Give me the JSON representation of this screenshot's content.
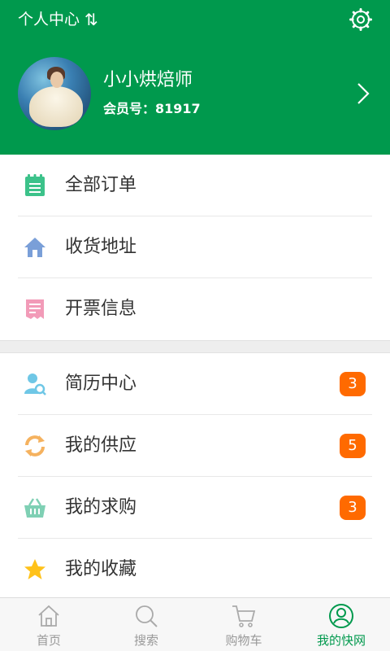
{
  "header": {
    "title": "个人中心",
    "swap_icon": "⇅",
    "username": "小小烘焙师",
    "member_label": "会员号：",
    "member_number": "81917"
  },
  "menu_group_1": [
    {
      "label": "全部订单",
      "icon": "order-list-icon",
      "color": "#3cc28a"
    },
    {
      "label": "收货地址",
      "icon": "home-icon",
      "color": "#7a9fd8"
    },
    {
      "label": "开票信息",
      "icon": "invoice-icon",
      "color": "#f29bb8"
    }
  ],
  "menu_group_2": [
    {
      "label": "简历中心",
      "icon": "resume-user-search-icon",
      "badge": "3"
    },
    {
      "label": "我的供应",
      "icon": "refresh-arrows-icon",
      "badge": "5"
    },
    {
      "label": "我的求购",
      "icon": "basket-icon",
      "badge": "3"
    },
    {
      "label": "我的收藏",
      "icon": "star-icon"
    }
  ],
  "tabbar": [
    {
      "label": "首页",
      "icon": "home-outline-icon"
    },
    {
      "label": "搜索",
      "icon": "search-icon"
    },
    {
      "label": "购物车",
      "icon": "cart-icon"
    },
    {
      "label": "我的快网",
      "icon": "user-circle-icon",
      "active": true
    }
  ],
  "colors": {
    "brand_green": "#00994d",
    "badge_orange": "#ff6a00",
    "star_yellow": "#ffc21a"
  }
}
